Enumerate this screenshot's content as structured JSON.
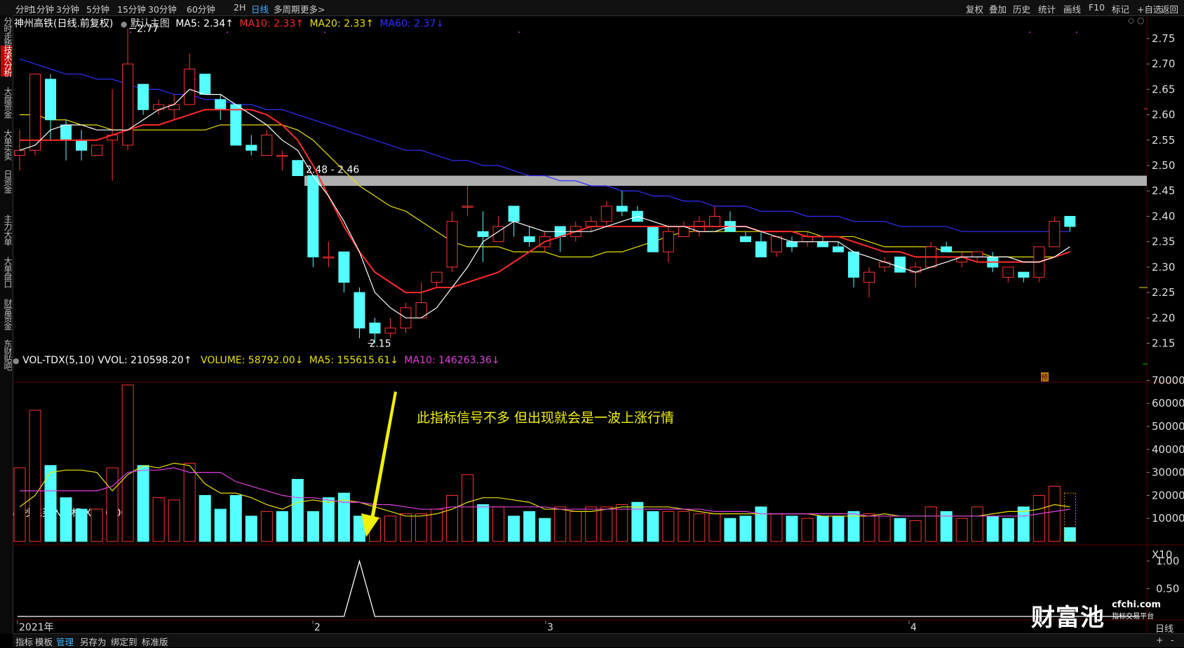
{
  "toolbar": {
    "periods": [
      "分时",
      "1分钟",
      "3分钟",
      "5分钟",
      "15分钟",
      "30分钟",
      "60分钟",
      "2H",
      "日线",
      "多周期",
      "更多>"
    ],
    "active_period": "日线",
    "right": [
      "复权",
      "叠加",
      "历史",
      "统计",
      "画线",
      "F10",
      "标记",
      "+自选",
      "返回"
    ]
  },
  "left_tabs": [
    "分时走势",
    "技术分析",
    "大盘资金",
    "大单买卖",
    "日资金",
    "主力大单",
    "大单盘口",
    "财富资金",
    "东财贴吧"
  ],
  "active_left_tab": "技术分析",
  "right_tabs": [
    "日线"
  ],
  "main_header": {
    "stock": "神州高铁(日线.前复权)",
    "template": "默认主图",
    "ma5": "MA5: 2.34↑",
    "ma10": "MA10: 2.33↑",
    "ma20": "MA20: 2.33↑",
    "ma60": "MA60: 2.37↓",
    "colors": {
      "ma5": "#ffffff",
      "ma10": "#ff2a2a",
      "ma20": "#e8e000",
      "ma60": "#3030ff"
    }
  },
  "price_axis": [
    "2.75",
    "2.70",
    "2.65",
    "2.60",
    "2.55",
    "2.50",
    "2.45",
    "2.40",
    "2.35",
    "2.30",
    "2.25",
    "2.20",
    "2.15"
  ],
  "annotations": {
    "high": "2.77",
    "low": "2.15",
    "zone": "2.48 - 2.46",
    "forecast_badge": "预",
    "note": "此指标信号不多  但出现就会是一波上涨行情"
  },
  "volume_header": {
    "name": "VOL-TDX(5,10)",
    "vvol": "VVOL: 210598.20↑",
    "volume": "VOLUME: 58792.00↓",
    "ma5": "MA5: 155615.61↓",
    "ma10": "MA10: 146263.36↓"
  },
  "volume_axis": [
    "70000",
    "60000",
    "50000",
    "40000",
    "30000",
    "20000",
    "10000"
  ],
  "volume_unit": "X10",
  "indicator_header": {
    "name": "抄底买入指标",
    "xg": "XG: 0.00"
  },
  "indicator_axis": [
    "1.00",
    "0.50"
  ],
  "date_axis": [
    "2021年",
    "2",
    "3",
    "4"
  ],
  "bottom_tabs": [
    "指标",
    "模板",
    "管理",
    "另存为",
    "绑定到",
    "标准版"
  ],
  "active_bottom_tab": "管理",
  "corner_buttons": [
    "+",
    "-"
  ],
  "logo": {
    "brand": "财富池",
    "domain": "cfchi.com",
    "tagline": "指标交易平台"
  },
  "chart_data": {
    "type": "candlestick",
    "up_color": "#ff3333",
    "down_color": "#54ffff",
    "candles": [
      [
        2.52,
        2.57,
        2.49,
        2.53
      ],
      [
        2.53,
        2.68,
        2.52,
        2.68
      ],
      [
        2.67,
        2.68,
        2.55,
        2.59
      ],
      [
        2.58,
        2.59,
        2.51,
        2.55
      ],
      [
        2.55,
        2.57,
        2.51,
        2.53
      ],
      [
        2.52,
        2.54,
        2.52,
        2.54
      ],
      [
        2.55,
        2.65,
        2.47,
        2.56
      ],
      [
        2.54,
        2.77,
        2.53,
        2.7
      ],
      [
        2.66,
        2.66,
        2.6,
        2.61
      ],
      [
        2.61,
        2.63,
        2.6,
        2.62
      ],
      [
        2.61,
        2.64,
        2.59,
        2.62
      ],
      [
        2.62,
        2.72,
        2.62,
        2.69
      ],
      [
        2.68,
        2.68,
        2.64,
        2.64
      ],
      [
        2.63,
        2.64,
        2.59,
        2.61
      ],
      [
        2.62,
        2.62,
        2.54,
        2.54
      ],
      [
        2.54,
        2.56,
        2.52,
        2.53
      ],
      [
        2.52,
        2.57,
        2.52,
        2.56
      ],
      [
        2.52,
        2.53,
        2.49,
        2.52
      ],
      [
        2.51,
        2.51,
        2.48,
        2.48
      ],
      [
        2.48,
        2.48,
        2.3,
        2.32
      ],
      [
        2.32,
        2.35,
        2.3,
        2.32
      ],
      [
        2.33,
        2.33,
        2.25,
        2.27
      ],
      [
        2.25,
        2.26,
        2.16,
        2.18
      ],
      [
        2.19,
        2.2,
        2.15,
        2.17
      ],
      [
        2.17,
        2.2,
        2.16,
        2.18
      ],
      [
        2.18,
        2.23,
        2.17,
        2.22
      ],
      [
        2.2,
        2.27,
        2.2,
        2.23
      ],
      [
        2.27,
        2.29,
        2.26,
        2.29
      ],
      [
        2.3,
        2.41,
        2.29,
        2.39
      ],
      [
        2.42,
        2.46,
        2.4,
        2.42
      ],
      [
        2.37,
        2.41,
        2.31,
        2.36
      ],
      [
        2.35,
        2.4,
        2.35,
        2.38
      ],
      [
        2.42,
        2.42,
        2.36,
        2.39
      ],
      [
        2.36,
        2.38,
        2.34,
        2.35
      ],
      [
        2.34,
        2.37,
        2.33,
        2.36
      ],
      [
        2.38,
        2.38,
        2.33,
        2.36
      ],
      [
        2.36,
        2.39,
        2.35,
        2.38
      ],
      [
        2.38,
        2.4,
        2.37,
        2.39
      ],
      [
        2.39,
        2.43,
        2.38,
        2.42
      ],
      [
        2.42,
        2.45,
        2.4,
        2.41
      ],
      [
        2.41,
        2.42,
        2.39,
        2.39
      ],
      [
        2.38,
        2.38,
        2.33,
        2.33
      ],
      [
        2.33,
        2.38,
        2.31,
        2.37
      ],
      [
        2.36,
        2.39,
        2.36,
        2.38
      ],
      [
        2.37,
        2.4,
        2.36,
        2.39
      ],
      [
        2.38,
        2.42,
        2.38,
        2.4
      ],
      [
        2.39,
        2.41,
        2.37,
        2.37
      ],
      [
        2.36,
        2.37,
        2.35,
        2.35
      ],
      [
        2.35,
        2.37,
        2.32,
        2.32
      ],
      [
        2.33,
        2.36,
        2.32,
        2.36
      ],
      [
        2.35,
        2.36,
        2.33,
        2.34
      ],
      [
        2.35,
        2.37,
        2.34,
        2.36
      ],
      [
        2.35,
        2.36,
        2.34,
        2.34
      ],
      [
        2.34,
        2.35,
        2.33,
        2.33
      ],
      [
        2.33,
        2.33,
        2.26,
        2.28
      ],
      [
        2.27,
        2.3,
        2.24,
        2.29
      ],
      [
        2.3,
        2.32,
        2.29,
        2.31
      ],
      [
        2.32,
        2.32,
        2.29,
        2.29
      ],
      [
        2.29,
        2.31,
        2.26,
        2.3
      ],
      [
        2.3,
        2.35,
        2.3,
        2.34
      ],
      [
        2.34,
        2.35,
        2.33,
        2.33
      ],
      [
        2.31,
        2.33,
        2.3,
        2.32
      ],
      [
        2.32,
        2.33,
        2.31,
        2.33
      ],
      [
        2.32,
        2.33,
        2.29,
        2.3
      ],
      [
        2.28,
        2.3,
        2.27,
        2.3
      ],
      [
        2.29,
        2.29,
        2.27,
        2.28
      ],
      [
        2.28,
        2.34,
        2.27,
        2.34
      ],
      [
        2.34,
        2.4,
        2.34,
        2.39
      ],
      [
        2.4,
        2.4,
        2.37,
        2.38
      ]
    ],
    "volume": [
      32000,
      57000,
      33000,
      19000,
      14000,
      14000,
      32000,
      68000,
      33000,
      19000,
      18000,
      34000,
      20000,
      14000,
      20000,
      11000,
      13000,
      13000,
      27000,
      13000,
      19000,
      21000,
      11000,
      10000,
      11000,
      12000,
      12000,
      14000,
      20000,
      29000,
      16000,
      15000,
      11000,
      13000,
      10000,
      15000,
      13000,
      15000,
      15000,
      16000,
      17000,
      13000,
      13000,
      13000,
      12000,
      12000,
      10000,
      11000,
      15000,
      12000,
      11000,
      10000,
      11000,
      11000,
      13000,
      12000,
      11000,
      10000,
      9000,
      15000,
      13000,
      10000,
      15000,
      11000,
      10000,
      15000,
      20000,
      24000,
      6000
    ],
    "volume_up": [
      true,
      true,
      false,
      false,
      false,
      true,
      true,
      true,
      false,
      true,
      true,
      true,
      false,
      false,
      false,
      false,
      true,
      false,
      false,
      false,
      false,
      false,
      false,
      true,
      true,
      true,
      true,
      true,
      true,
      true,
      false,
      true,
      false,
      false,
      false,
      true,
      true,
      true,
      true,
      true,
      false,
      false,
      true,
      true,
      true,
      true,
      false,
      false,
      false,
      true,
      false,
      true,
      false,
      false,
      false,
      true,
      true,
      false,
      true,
      true,
      false,
      true,
      true,
      false,
      false,
      false,
      true,
      true,
      false
    ],
    "ma5": [
      2.53,
      2.54,
      2.57,
      2.58,
      2.58,
      2.57,
      2.57,
      2.57,
      2.59,
      2.61,
      2.62,
      2.65,
      2.64,
      2.64,
      2.62,
      2.6,
      2.58,
      2.55,
      2.53,
      2.48,
      2.44,
      2.39,
      2.33,
      2.25,
      2.22,
      2.2,
      2.2,
      2.22,
      2.26,
      2.3,
      2.35,
      2.37,
      2.39,
      2.38,
      2.37,
      2.37,
      2.37,
      2.37,
      2.38,
      2.39,
      2.4,
      2.39,
      2.38,
      2.38,
      2.37,
      2.37,
      2.38,
      2.38,
      2.37,
      2.36,
      2.35,
      2.35,
      2.35,
      2.35,
      2.33,
      2.32,
      2.31,
      2.3,
      2.29,
      2.3,
      2.31,
      2.32,
      2.32,
      2.32,
      2.32,
      2.31,
      2.31,
      2.32,
      2.34
    ],
    "ma10": [
      2.55,
      2.55,
      2.55,
      2.55,
      2.55,
      2.55,
      2.56,
      2.57,
      2.58,
      2.58,
      2.59,
      2.6,
      2.61,
      2.61,
      2.61,
      2.61,
      2.6,
      2.58,
      2.55,
      2.5,
      2.44,
      2.38,
      2.33,
      2.29,
      2.27,
      2.25,
      2.25,
      2.26,
      2.26,
      2.27,
      2.28,
      2.29,
      2.31,
      2.33,
      2.35,
      2.36,
      2.37,
      2.38,
      2.38,
      2.38,
      2.38,
      2.38,
      2.38,
      2.38,
      2.38,
      2.38,
      2.38,
      2.38,
      2.37,
      2.37,
      2.37,
      2.36,
      2.36,
      2.36,
      2.35,
      2.34,
      2.33,
      2.33,
      2.32,
      2.32,
      2.32,
      2.32,
      2.31,
      2.31,
      2.31,
      2.31,
      2.31,
      2.32,
      2.33
    ],
    "ma20": [
      2.6,
      2.6,
      2.59,
      2.59,
      2.58,
      2.58,
      2.57,
      2.57,
      2.57,
      2.57,
      2.57,
      2.57,
      2.57,
      2.58,
      2.58,
      2.58,
      2.58,
      2.58,
      2.57,
      2.55,
      2.52,
      2.49,
      2.46,
      2.44,
      2.42,
      2.41,
      2.39,
      2.37,
      2.35,
      2.34,
      2.34,
      2.34,
      2.33,
      2.33,
      2.33,
      2.32,
      2.32,
      2.32,
      2.33,
      2.33,
      2.34,
      2.35,
      2.36,
      2.37,
      2.37,
      2.37,
      2.37,
      2.37,
      2.37,
      2.37,
      2.37,
      2.37,
      2.36,
      2.36,
      2.36,
      2.35,
      2.34,
      2.34,
      2.34,
      2.34,
      2.33,
      2.33,
      2.33,
      2.32,
      2.32,
      2.32,
      2.32,
      2.32,
      2.33
    ],
    "ma60": [
      2.71,
      2.7,
      2.69,
      2.68,
      2.68,
      2.67,
      2.67,
      2.66,
      2.65,
      2.65,
      2.64,
      2.64,
      2.63,
      2.63,
      2.62,
      2.62,
      2.61,
      2.61,
      2.6,
      2.59,
      2.58,
      2.57,
      2.56,
      2.55,
      2.54,
      2.53,
      2.53,
      2.52,
      2.51,
      2.51,
      2.5,
      2.5,
      2.49,
      2.48,
      2.48,
      2.47,
      2.47,
      2.46,
      2.46,
      2.45,
      2.45,
      2.44,
      2.44,
      2.43,
      2.43,
      2.42,
      2.42,
      2.42,
      2.41,
      2.41,
      2.41,
      2.4,
      2.4,
      2.4,
      2.39,
      2.39,
      2.39,
      2.38,
      2.38,
      2.38,
      2.38,
      2.37,
      2.37,
      2.37,
      2.37,
      2.37,
      2.37,
      2.37,
      2.37
    ],
    "vol_ma5": [
      15000,
      20000,
      30000,
      31000,
      31000,
      30000,
      22000,
      29000,
      33000,
      32000,
      34000,
      33000,
      25000,
      21000,
      21000,
      19000,
      16000,
      14000,
      17000,
      18000,
      17000,
      18000,
      17000,
      15000,
      13000,
      11000,
      11000,
      12000,
      14000,
      17000,
      19000,
      19000,
      18000,
      17000,
      14000,
      14000,
      13000,
      13000,
      14000,
      15000,
      15000,
      15000,
      15000,
      14000,
      13000,
      12000,
      12000,
      12000,
      12000,
      12000,
      12000,
      12000,
      11000,
      11000,
      11000,
      11000,
      12000,
      11000,
      11000,
      11000,
      11000,
      11000,
      11000,
      12000,
      13000,
      13000,
      14000,
      16000,
      15000
    ],
    "vol_ma10": [
      22000,
      22000,
      22000,
      22000,
      22000,
      22000,
      24000,
      30000,
      31000,
      31000,
      32000,
      30000,
      30000,
      30000,
      26000,
      24000,
      22000,
      20000,
      19000,
      19000,
      18000,
      17000,
      17000,
      16000,
      16000,
      15000,
      14000,
      14000,
      15000,
      15000,
      15000,
      15000,
      15000,
      15000,
      15000,
      14000,
      14000,
      14000,
      14000,
      14000,
      14000,
      14000,
      14000,
      14000,
      14000,
      13000,
      13000,
      13000,
      12000,
      12000,
      12000,
      12000,
      12000,
      12000,
      12000,
      11000,
      11000,
      11000,
      11000,
      11000,
      11000,
      11000,
      11000,
      11000,
      11000,
      11000,
      12000,
      13000,
      14000
    ],
    "indicator_signal_index": 22,
    "indicator_range": [
      0,
      1
    ],
    "price_range": [
      2.13,
      2.79
    ],
    "volume_range": [
      0,
      75000
    ]
  }
}
